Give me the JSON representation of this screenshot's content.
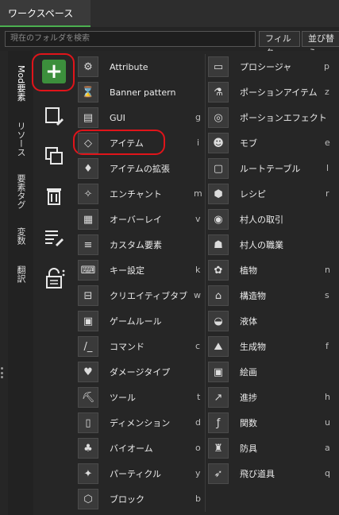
{
  "tab": {
    "title": "ワークスペース"
  },
  "toolbar": {
    "search_placeholder": "現在のフォルダを検索",
    "filter_label": "フィルタ",
    "sort_label": "並び替え"
  },
  "vertical_tabs": [
    "Mod要素",
    "リソース",
    "要素タグ",
    "変数",
    "翻訳"
  ],
  "tools": [
    {
      "name": "add-element",
      "icon": "plus-icon"
    },
    {
      "name": "new-file",
      "icon": "new-file-icon"
    },
    {
      "name": "duplicate",
      "icon": "duplicate-icon"
    },
    {
      "name": "delete",
      "icon": "trash-icon"
    },
    {
      "name": "edit-list",
      "icon": "list-edit-icon"
    },
    {
      "name": "lock",
      "icon": "lock-icon"
    }
  ],
  "left_column": [
    {
      "label": "Attribute",
      "key": "",
      "icon": "attribute-icon"
    },
    {
      "label": "Banner pattern",
      "key": "",
      "icon": "banner-icon"
    },
    {
      "label": "GUI",
      "key": "g",
      "icon": "gui-icon"
    },
    {
      "label": "アイテム",
      "key": "i",
      "icon": "diamond-icon"
    },
    {
      "label": "アイテムの拡張",
      "key": "",
      "icon": "item-extension-icon"
    },
    {
      "label": "エンチャント",
      "key": "m",
      "icon": "enchant-icon"
    },
    {
      "label": "オーバーレイ",
      "key": "v",
      "icon": "overlay-icon"
    },
    {
      "label": "カスタム要素",
      "key": "",
      "icon": "custom-element-icon"
    },
    {
      "label": "キー設定",
      "key": "k",
      "icon": "keybind-icon"
    },
    {
      "label": "クリエイティブタブ",
      "key": "w",
      "icon": "tab-icon"
    },
    {
      "label": "ゲームルール",
      "key": "",
      "icon": "gamerule-icon"
    },
    {
      "label": "コマンド",
      "key": "c",
      "icon": "command-icon"
    },
    {
      "label": "ダメージタイプ",
      "key": "",
      "icon": "damage-icon"
    },
    {
      "label": "ツール",
      "key": "t",
      "icon": "pickaxe-icon"
    },
    {
      "label": "ディメンション",
      "key": "d",
      "icon": "dimension-icon"
    },
    {
      "label": "バイオーム",
      "key": "o",
      "icon": "biome-icon"
    },
    {
      "label": "パーティクル",
      "key": "y",
      "icon": "particle-icon"
    },
    {
      "label": "ブロック",
      "key": "b",
      "icon": "block-icon"
    }
  ],
  "right_column": [
    {
      "label": "プロシージャ",
      "key": "p",
      "icon": "procedure-icon"
    },
    {
      "label": "ポーションアイテム",
      "key": "z",
      "icon": "potion-icon"
    },
    {
      "label": "ポーションエフェクト",
      "key": "",
      "icon": "potion-effect-icon"
    },
    {
      "label": "モブ",
      "key": "e",
      "icon": "mob-icon"
    },
    {
      "label": "ルートテーブル",
      "key": "l",
      "icon": "loot-table-icon"
    },
    {
      "label": "レシピ",
      "key": "r",
      "icon": "recipe-icon"
    },
    {
      "label": "村人の取引",
      "key": "",
      "icon": "villager-trade-icon"
    },
    {
      "label": "村人の職業",
      "key": "",
      "icon": "villager-profession-icon"
    },
    {
      "label": "植物",
      "key": "n",
      "icon": "plant-icon"
    },
    {
      "label": "構造物",
      "key": "s",
      "icon": "structure-icon"
    },
    {
      "label": "液体",
      "key": "",
      "icon": "fluid-icon"
    },
    {
      "label": "生成物",
      "key": "f",
      "icon": "feature-icon"
    },
    {
      "label": "絵画",
      "key": "",
      "icon": "painting-icon"
    },
    {
      "label": "進捗",
      "key": "h",
      "icon": "advancement-icon"
    },
    {
      "label": "関数",
      "key": "u",
      "icon": "function-icon"
    },
    {
      "label": "防具",
      "key": "a",
      "icon": "armor-icon"
    },
    {
      "label": "飛び道具",
      "key": "q",
      "icon": "projectile-icon"
    }
  ],
  "colors": {
    "accent": "#4caf50",
    "highlight": "#e0141a",
    "background": "#262626"
  }
}
